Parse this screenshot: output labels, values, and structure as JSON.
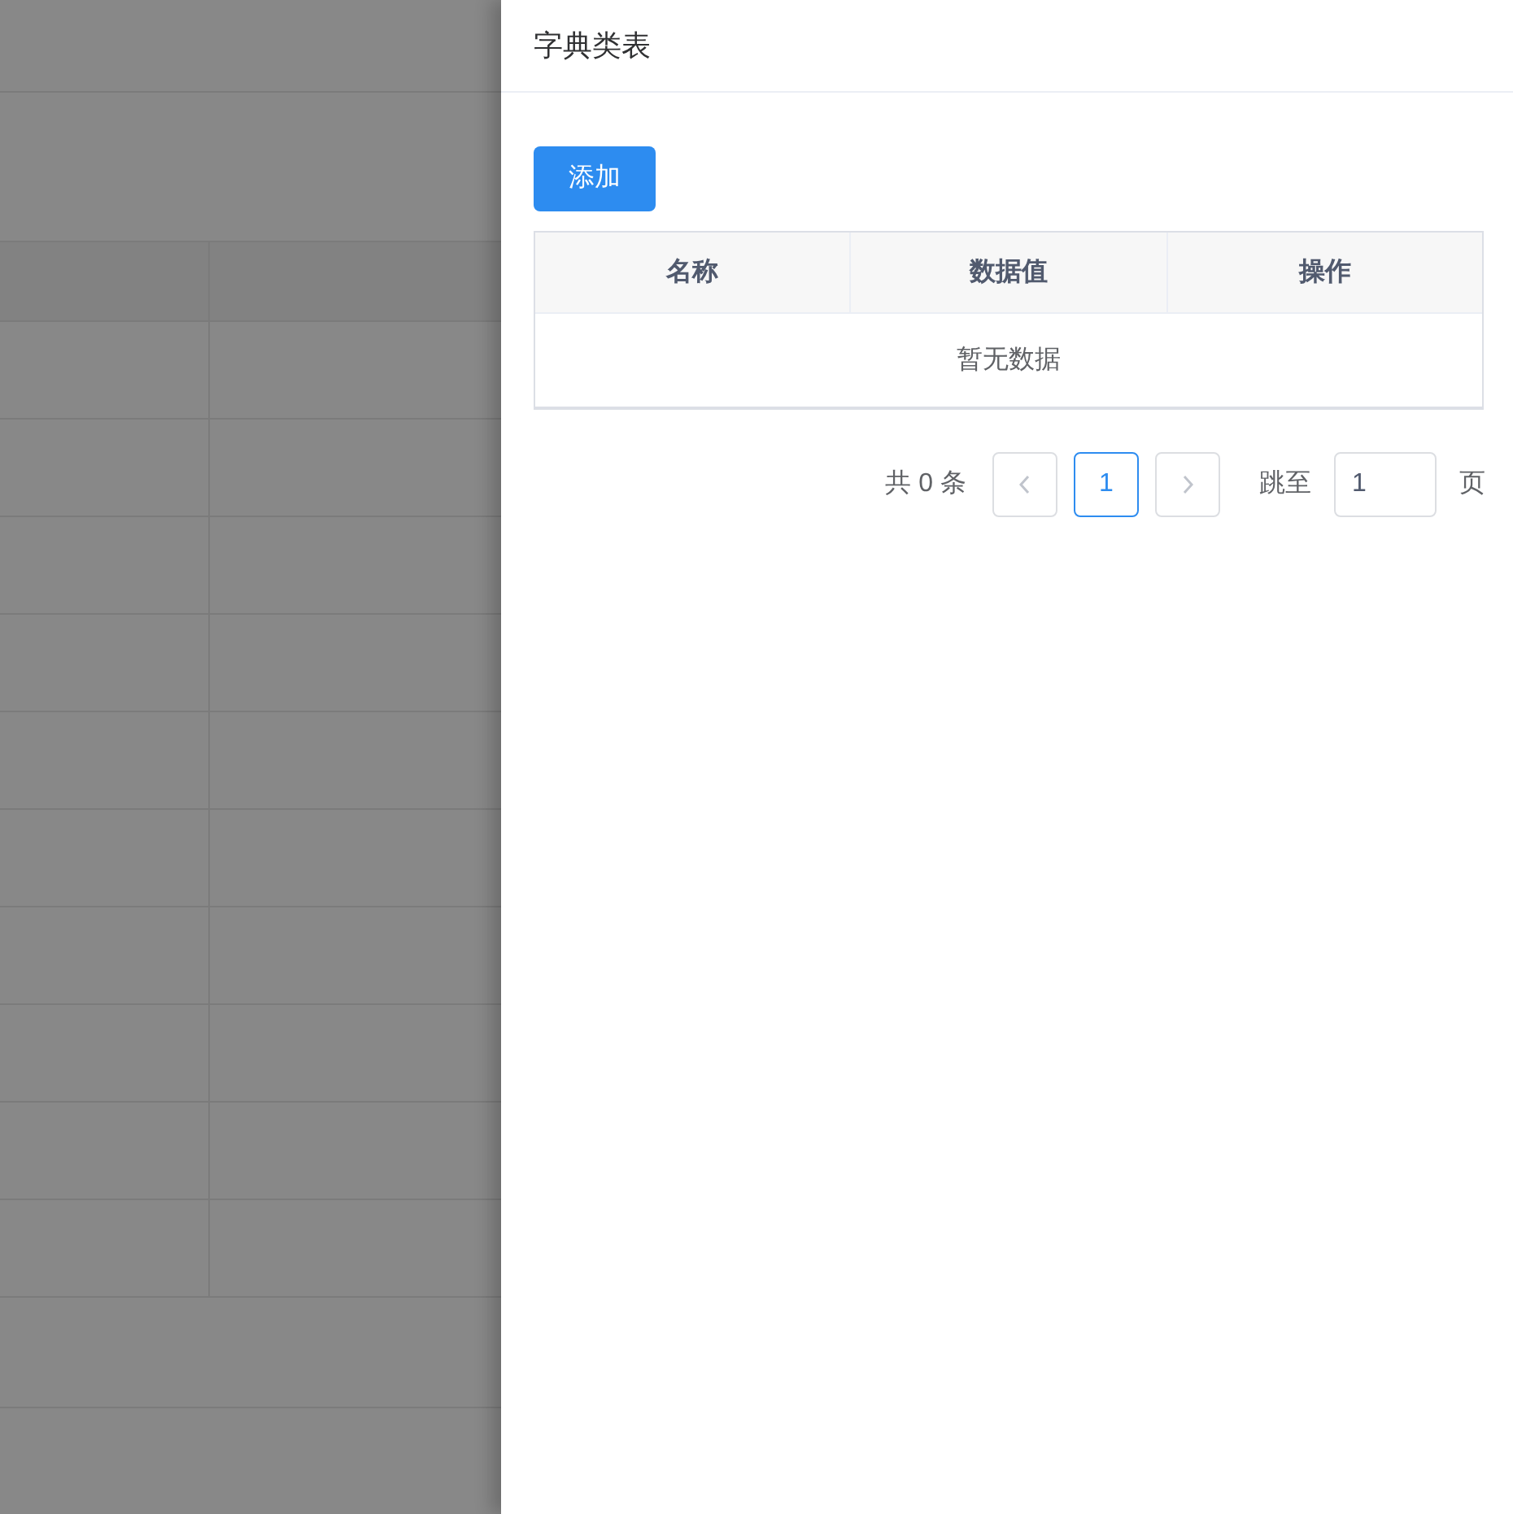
{
  "drawer": {
    "title": "字典类表"
  },
  "add_button": {
    "label": "添加"
  },
  "table": {
    "columns": [
      "名称",
      "数据值",
      "操作"
    ],
    "empty_text": "暂无数据"
  },
  "pagination": {
    "total": "共 0 条",
    "prev": {
      "disabled": true
    },
    "pages": [
      {
        "label": "1",
        "selected": true
      }
    ],
    "next": {
      "disabled": true
    },
    "jump_label": "跳至",
    "jump_value": "1",
    "page_unit": "页"
  }
}
